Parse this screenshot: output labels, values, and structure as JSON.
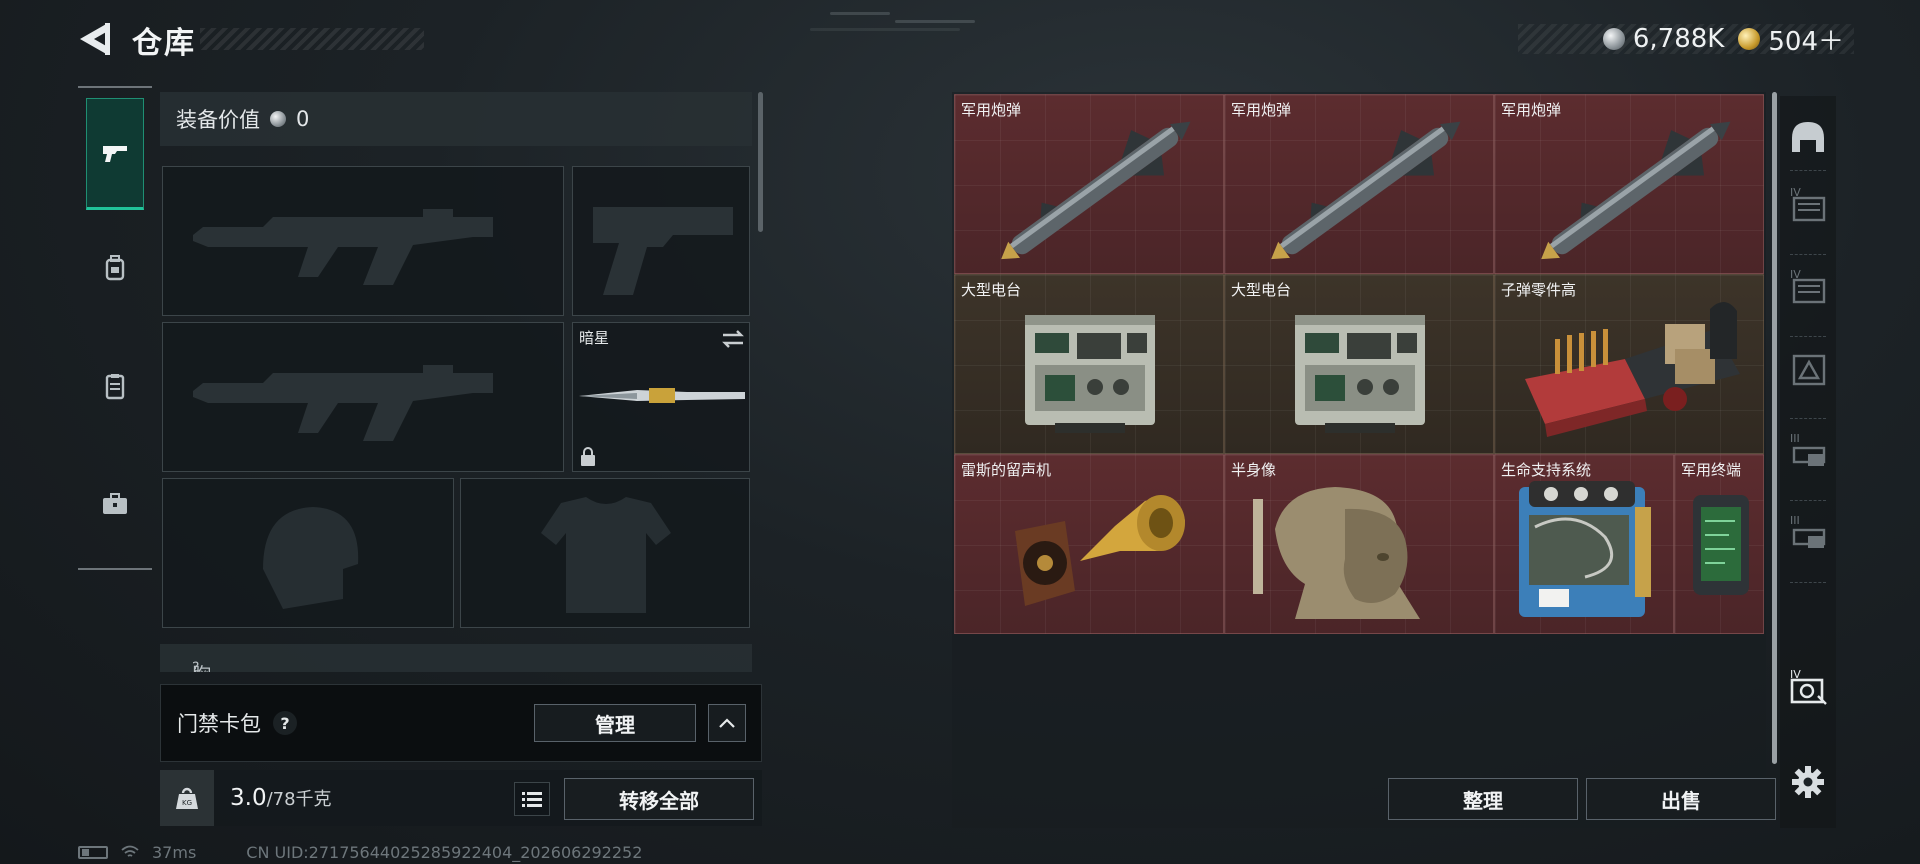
{
  "header": {
    "title": "仓库",
    "currencies": [
      {
        "name": "silver",
        "value": "6,788K"
      },
      {
        "name": "gold",
        "value": "504＋"
      }
    ]
  },
  "tabs": [
    {
      "name": "weapons",
      "icon": "pistol-icon",
      "active": true
    },
    {
      "name": "armor",
      "icon": "backpack-icon",
      "active": false
    },
    {
      "name": "consumables",
      "icon": "clipboard-icon",
      "active": false
    },
    {
      "name": "items",
      "icon": "briefcase-icon",
      "active": false
    }
  ],
  "equipment": {
    "value_label": "装备价值",
    "value": "0",
    "melee_slot_label": "暗星",
    "chest_label_partial": "胸挂",
    "chest_count_partial": "?"
  },
  "card_pack": {
    "label": "门禁卡包",
    "help": "?",
    "manage_label": "管理"
  },
  "weight": {
    "current": "3.0",
    "max": "/78千克",
    "transfer_all_label": "转移全部"
  },
  "status": {
    "ping": "37ms",
    "uid": "CN UID:27175644025285922404_202606292252"
  },
  "stash": {
    "items": [
      {
        "label": "军用炮弹",
        "art": "missile"
      },
      {
        "label": "军用炮弹",
        "art": "missile"
      },
      {
        "label": "军用炮弹",
        "art": "missile"
      },
      {
        "label": "大型电台",
        "art": "radio"
      },
      {
        "label": "大型电台",
        "art": "radio"
      },
      {
        "label": "子弹零件高",
        "art": "ammo-parts"
      },
      {
        "label": "雷斯的留声机",
        "art": "gramophone"
      },
      {
        "label": "半身像",
        "art": "bust"
      },
      {
        "label": "生命支持系统",
        "art": "life-support"
      },
      {
        "label": "军用终端",
        "art": "terminal"
      }
    ],
    "sort_label": "整理",
    "sell_label": "出售"
  },
  "right_rail": [
    {
      "icon": "helmet-tab-icon",
      "text": ""
    },
    {
      "icon": "tier-4-box-icon",
      "text": "IV"
    },
    {
      "icon": "tier-4-box-icon",
      "text": "IV"
    },
    {
      "icon": "triangle-box-icon",
      "text": ""
    },
    {
      "icon": "tier-3-box-icon",
      "text": "III"
    },
    {
      "icon": "tier-3-box-icon",
      "text": "III"
    },
    {
      "icon": "tier-4-safe-icon",
      "text": "IV"
    },
    {
      "icon": "settings-gear-icon",
      "text": ""
    }
  ]
}
